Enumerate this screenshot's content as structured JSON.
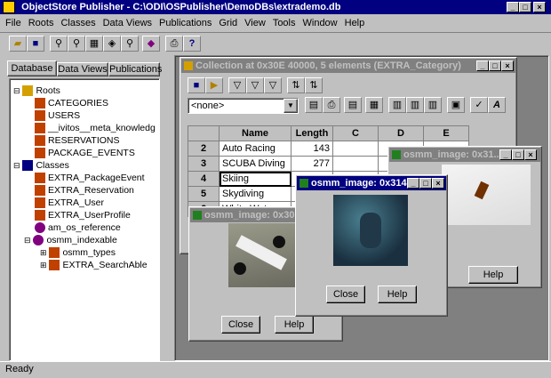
{
  "app": {
    "title": "ObjectStore Publisher - C:\\ODI\\OSPublisher\\DemoDBs\\extrademo.db",
    "status": "Ready"
  },
  "menu": [
    "File",
    "Roots",
    "Classes",
    "Data Views",
    "Publications",
    "Grid",
    "View",
    "Tools",
    "Window",
    "Help"
  ],
  "tabs": [
    "Database",
    "Data Views",
    "Publications"
  ],
  "tree": {
    "roots_label": "Roots",
    "roots": [
      "CATEGORIES",
      "USERS",
      "__ivitos__meta_knowledge",
      "RESERVATIONS",
      "PACKAGE_EVENTS"
    ],
    "classes_label": "Classes",
    "classes": [
      "EXTRA_PackageEvent",
      "EXTRA_Reservation",
      "EXTRA_User",
      "EXTRA_UserProfile",
      "am_os_reference",
      "osmm_indexable"
    ],
    "sub": [
      "osmm_types",
      "EXTRA_SearchAble"
    ]
  },
  "collection": {
    "title": "Collection at 0x30E 40000, 5 elements (EXTRA_Category)",
    "filter": "<none>",
    "columns": [
      "Name",
      "Length",
      "C",
      "D",
      "E"
    ],
    "rows": [
      {
        "n": "2",
        "name": "Auto Racing",
        "length": "143"
      },
      {
        "n": "3",
        "name": "SCUBA Diving",
        "length": "277"
      },
      {
        "n": "4",
        "name": "Skiing",
        "length": "90"
      },
      {
        "n": "5",
        "name": "Skydiving",
        "length": ""
      },
      {
        "n": "6",
        "name": "White Water",
        "length": ""
      }
    ]
  },
  "img1": {
    "title": "osmm_image: 0x306...",
    "close": "Close",
    "help": "Help"
  },
  "img2": {
    "title": "osmm_image: 0x314...",
    "close": "Close",
    "help": "Help"
  },
  "img3": {
    "title": "osmm_image: 0x31...",
    "help": "Help"
  }
}
